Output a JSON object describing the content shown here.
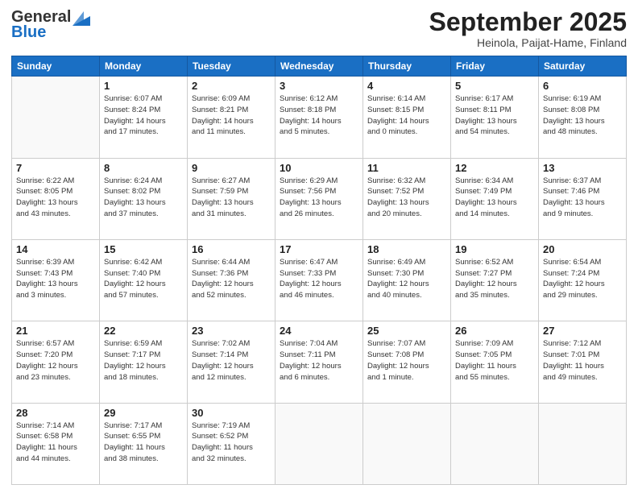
{
  "header": {
    "logo": {
      "general": "General",
      "blue": "Blue"
    },
    "month": "September 2025",
    "location": "Heinola, Paijat-Hame, Finland"
  },
  "weekdays": [
    "Sunday",
    "Monday",
    "Tuesday",
    "Wednesday",
    "Thursday",
    "Friday",
    "Saturday"
  ],
  "weeks": [
    [
      {
        "day": "",
        "info": ""
      },
      {
        "day": "1",
        "info": "Sunrise: 6:07 AM\nSunset: 8:24 PM\nDaylight: 14 hours\nand 17 minutes."
      },
      {
        "day": "2",
        "info": "Sunrise: 6:09 AM\nSunset: 8:21 PM\nDaylight: 14 hours\nand 11 minutes."
      },
      {
        "day": "3",
        "info": "Sunrise: 6:12 AM\nSunset: 8:18 PM\nDaylight: 14 hours\nand 5 minutes."
      },
      {
        "day": "4",
        "info": "Sunrise: 6:14 AM\nSunset: 8:15 PM\nDaylight: 14 hours\nand 0 minutes."
      },
      {
        "day": "5",
        "info": "Sunrise: 6:17 AM\nSunset: 8:11 PM\nDaylight: 13 hours\nand 54 minutes."
      },
      {
        "day": "6",
        "info": "Sunrise: 6:19 AM\nSunset: 8:08 PM\nDaylight: 13 hours\nand 48 minutes."
      }
    ],
    [
      {
        "day": "7",
        "info": "Sunrise: 6:22 AM\nSunset: 8:05 PM\nDaylight: 13 hours\nand 43 minutes."
      },
      {
        "day": "8",
        "info": "Sunrise: 6:24 AM\nSunset: 8:02 PM\nDaylight: 13 hours\nand 37 minutes."
      },
      {
        "day": "9",
        "info": "Sunrise: 6:27 AM\nSunset: 7:59 PM\nDaylight: 13 hours\nand 31 minutes."
      },
      {
        "day": "10",
        "info": "Sunrise: 6:29 AM\nSunset: 7:56 PM\nDaylight: 13 hours\nand 26 minutes."
      },
      {
        "day": "11",
        "info": "Sunrise: 6:32 AM\nSunset: 7:52 PM\nDaylight: 13 hours\nand 20 minutes."
      },
      {
        "day": "12",
        "info": "Sunrise: 6:34 AM\nSunset: 7:49 PM\nDaylight: 13 hours\nand 14 minutes."
      },
      {
        "day": "13",
        "info": "Sunrise: 6:37 AM\nSunset: 7:46 PM\nDaylight: 13 hours\nand 9 minutes."
      }
    ],
    [
      {
        "day": "14",
        "info": "Sunrise: 6:39 AM\nSunset: 7:43 PM\nDaylight: 13 hours\nand 3 minutes."
      },
      {
        "day": "15",
        "info": "Sunrise: 6:42 AM\nSunset: 7:40 PM\nDaylight: 12 hours\nand 57 minutes."
      },
      {
        "day": "16",
        "info": "Sunrise: 6:44 AM\nSunset: 7:36 PM\nDaylight: 12 hours\nand 52 minutes."
      },
      {
        "day": "17",
        "info": "Sunrise: 6:47 AM\nSunset: 7:33 PM\nDaylight: 12 hours\nand 46 minutes."
      },
      {
        "day": "18",
        "info": "Sunrise: 6:49 AM\nSunset: 7:30 PM\nDaylight: 12 hours\nand 40 minutes."
      },
      {
        "day": "19",
        "info": "Sunrise: 6:52 AM\nSunset: 7:27 PM\nDaylight: 12 hours\nand 35 minutes."
      },
      {
        "day": "20",
        "info": "Sunrise: 6:54 AM\nSunset: 7:24 PM\nDaylight: 12 hours\nand 29 minutes."
      }
    ],
    [
      {
        "day": "21",
        "info": "Sunrise: 6:57 AM\nSunset: 7:20 PM\nDaylight: 12 hours\nand 23 minutes."
      },
      {
        "day": "22",
        "info": "Sunrise: 6:59 AM\nSunset: 7:17 PM\nDaylight: 12 hours\nand 18 minutes."
      },
      {
        "day": "23",
        "info": "Sunrise: 7:02 AM\nSunset: 7:14 PM\nDaylight: 12 hours\nand 12 minutes."
      },
      {
        "day": "24",
        "info": "Sunrise: 7:04 AM\nSunset: 7:11 PM\nDaylight: 12 hours\nand 6 minutes."
      },
      {
        "day": "25",
        "info": "Sunrise: 7:07 AM\nSunset: 7:08 PM\nDaylight: 12 hours\nand 1 minute."
      },
      {
        "day": "26",
        "info": "Sunrise: 7:09 AM\nSunset: 7:05 PM\nDaylight: 11 hours\nand 55 minutes."
      },
      {
        "day": "27",
        "info": "Sunrise: 7:12 AM\nSunset: 7:01 PM\nDaylight: 11 hours\nand 49 minutes."
      }
    ],
    [
      {
        "day": "28",
        "info": "Sunrise: 7:14 AM\nSunset: 6:58 PM\nDaylight: 11 hours\nand 44 minutes."
      },
      {
        "day": "29",
        "info": "Sunrise: 7:17 AM\nSunset: 6:55 PM\nDaylight: 11 hours\nand 38 minutes."
      },
      {
        "day": "30",
        "info": "Sunrise: 7:19 AM\nSunset: 6:52 PM\nDaylight: 11 hours\nand 32 minutes."
      },
      {
        "day": "",
        "info": ""
      },
      {
        "day": "",
        "info": ""
      },
      {
        "day": "",
        "info": ""
      },
      {
        "day": "",
        "info": ""
      }
    ]
  ]
}
